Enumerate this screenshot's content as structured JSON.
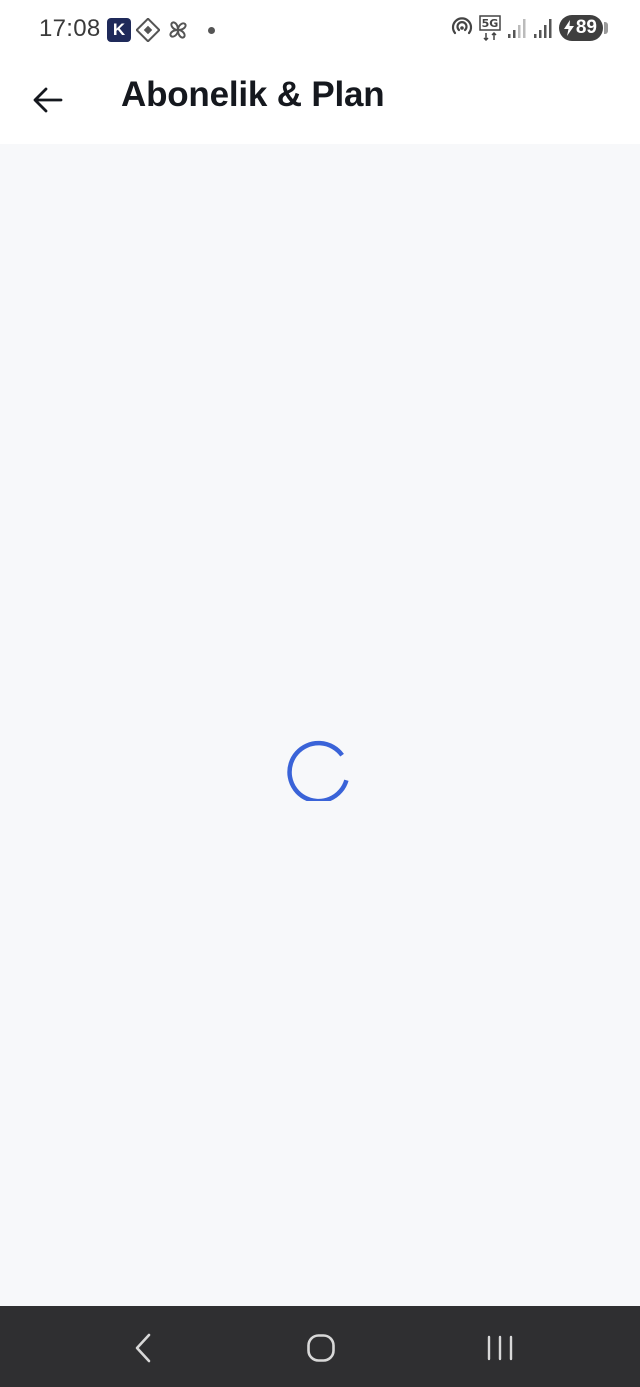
{
  "status_bar": {
    "time": "17:08",
    "app_badge_letter": "K",
    "network_label": "5G",
    "battery_level": "89"
  },
  "app_bar": {
    "title": "Abonelik & Plan"
  },
  "main": {
    "loading": true,
    "spinner_color": "#3a63d8"
  },
  "nav_bar": {
    "buttons": [
      "back",
      "home",
      "recents"
    ]
  },
  "colors": {
    "background": "#f7f8fa",
    "header": "#ffffff",
    "title": "#15181e",
    "nav_bar": "#2f2f31"
  }
}
